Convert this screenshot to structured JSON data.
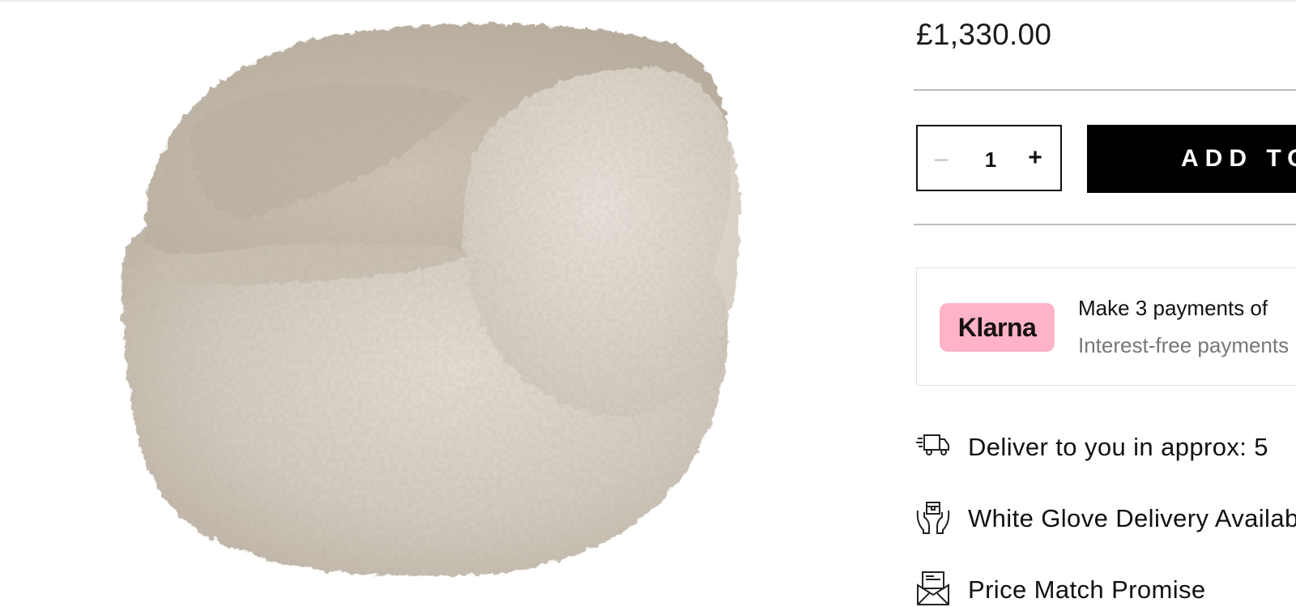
{
  "product": {
    "price": "£1,330.00"
  },
  "purchase": {
    "quantity": "1",
    "minus_glyph": "–",
    "plus_glyph": "+",
    "add_to_cart_label": "ADD TO CART"
  },
  "klarna": {
    "logo_text": "Klarna",
    "line1": "Make 3 payments of",
    "line2": "Interest-free payments",
    "logo_color": "#ffb3c7"
  },
  "features": [
    {
      "icon": "delivery-truck-icon",
      "label": "Deliver to you in approx: 5"
    },
    {
      "icon": "white-glove-box-icon",
      "label": "White Glove Delivery Available"
    },
    {
      "icon": "price-match-envelope-icon",
      "label": "Price Match Promise"
    }
  ],
  "colors": {
    "button_bg": "#000000",
    "divider": "#bdbdbd",
    "text": "#111111",
    "muted": "#777777"
  }
}
